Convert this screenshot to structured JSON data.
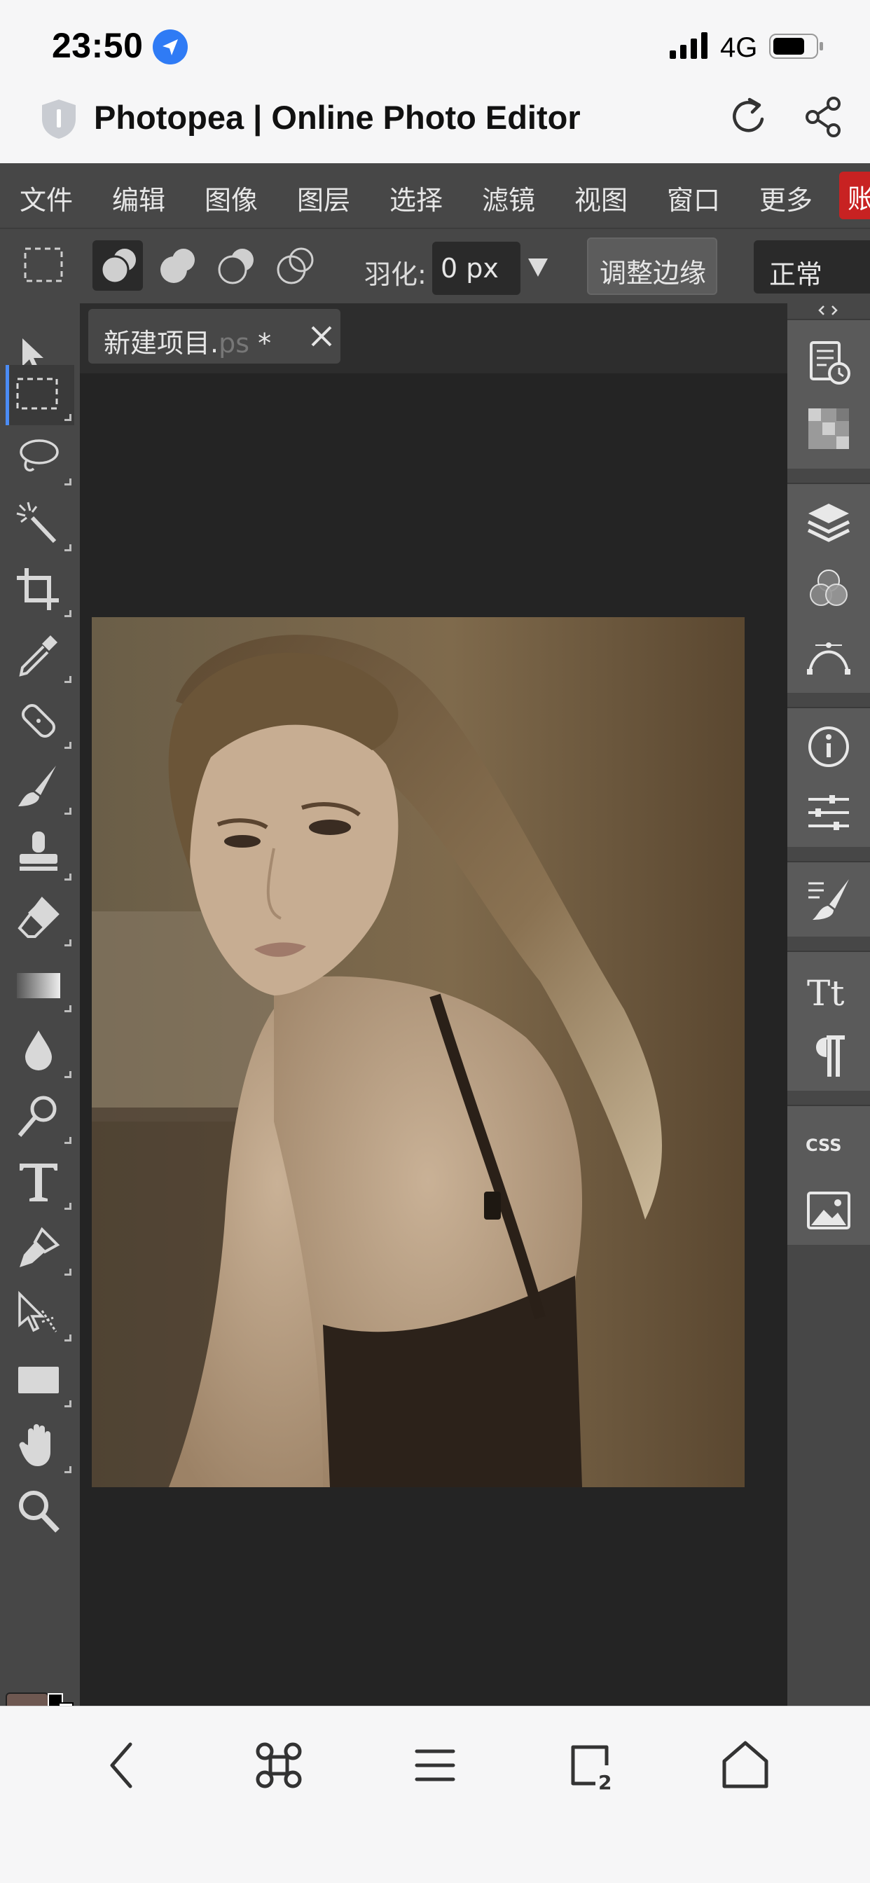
{
  "status_bar": {
    "time": "23:50",
    "network": "4G",
    "icons": [
      "location-arrow-icon",
      "signal-bars-icon",
      "battery-icon"
    ]
  },
  "browser": {
    "title": "Photopea | Online Photo Editor",
    "icons": [
      "shield-icon",
      "reload-icon",
      "share-icon"
    ]
  },
  "menu": {
    "items": [
      "文件",
      "编辑",
      "图像",
      "图层",
      "选择",
      "滤镜",
      "视图",
      "窗口",
      "更多"
    ],
    "overflow_label": "账"
  },
  "options_bar": {
    "feather_label": "羽化:",
    "feather_value": "0 px",
    "refine_edge_label": "调整边缘",
    "blend_mode": "正常"
  },
  "toolbar": {
    "tools": [
      "move",
      "rectangle-select",
      "lasso",
      "magic-wand",
      "crop",
      "eyedropper",
      "spot-healing",
      "brush",
      "clone-stamp",
      "eraser",
      "gradient",
      "blur",
      "dodge",
      "type",
      "pen",
      "path-select",
      "rectangle-shape",
      "hand",
      "zoom"
    ],
    "active_tool": "rectangle-select",
    "foreground_color": "#6e5851",
    "background_color": "#ffffff"
  },
  "document": {
    "tab_name": "新建项目.",
    "tab_ext": "ps",
    "tab_modified": " *"
  },
  "right_panels": [
    "history",
    "swatches",
    "layers",
    "channels",
    "paths",
    "info",
    "properties",
    "brushes",
    "character",
    "paragraph",
    "css",
    "image"
  ],
  "colors": {
    "accent": "#4b8cf5",
    "account_button": "#c82222",
    "location": "#2f7bf5"
  }
}
